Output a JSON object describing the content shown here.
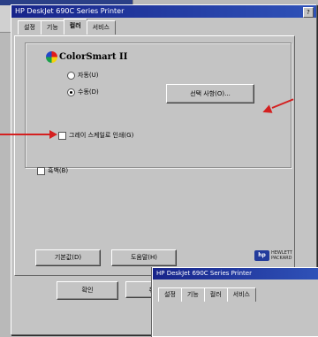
{
  "dialog": {
    "title": "HP DeskJet 690C Series Printer",
    "help_label": "?",
    "tabs": [
      {
        "label": "설정"
      },
      {
        "label": "기능"
      },
      {
        "label": "컬러"
      },
      {
        "label": "서비스"
      }
    ],
    "active_tab": 2,
    "colorsmart_logo": "ColorSmart II",
    "radios": [
      {
        "label": "자동(U)",
        "selected": false
      },
      {
        "label": "수동(D)",
        "selected": true
      }
    ],
    "options_button": "선택 사항(O)...",
    "checkbox_1": {
      "label": "그레이 스케일로 인쇄(G)",
      "checked": false
    },
    "checkbox_2": {
      "label": "흑백(B)",
      "checked": false
    },
    "defaults_button": "기본값(D)",
    "help_button": "도움말(H)",
    "ok_button": "확인",
    "cancel_button": "취",
    "hp_logo": {
      "mark": "hp",
      "text": "HEWLETT PACKARD"
    }
  },
  "second_window": {
    "title": "HP DeskJet 690C Series Printer",
    "tabs": [
      {
        "label": "설정"
      },
      {
        "label": "기능"
      },
      {
        "label": "컬러"
      },
      {
        "label": "서비스"
      }
    ]
  },
  "colors": {
    "titlebar": "#17248a",
    "face": "#c4c4c4",
    "annotation_arrow": "#d42020"
  }
}
